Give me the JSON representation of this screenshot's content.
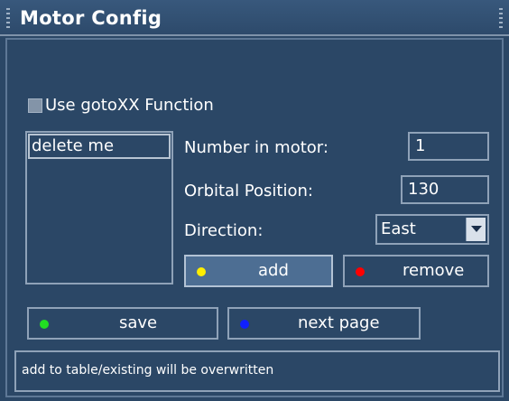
{
  "window": {
    "title": "Motor Config"
  },
  "options": {
    "gotoxx_label": "Use gotoXX Function",
    "gotoxx_checked": false
  },
  "table": {
    "items": [
      "delete me"
    ]
  },
  "form": {
    "number_label": "Number in motor:",
    "number_value": "1",
    "orbital_label": "Orbital Position:",
    "orbital_value": "130",
    "direction_label": "Direction:",
    "direction_value": "East"
  },
  "buttons": {
    "add": {
      "label": "add",
      "dot_color": "#ffee00"
    },
    "remove": {
      "label": "remove",
      "dot_color": "#ff0000"
    },
    "save": {
      "label": "save",
      "dot_color": "#22dd22"
    },
    "next_page": {
      "label": "next page",
      "dot_color": "#1020ff"
    }
  },
  "status": {
    "text": "add to table/existing will be overwritten"
  }
}
